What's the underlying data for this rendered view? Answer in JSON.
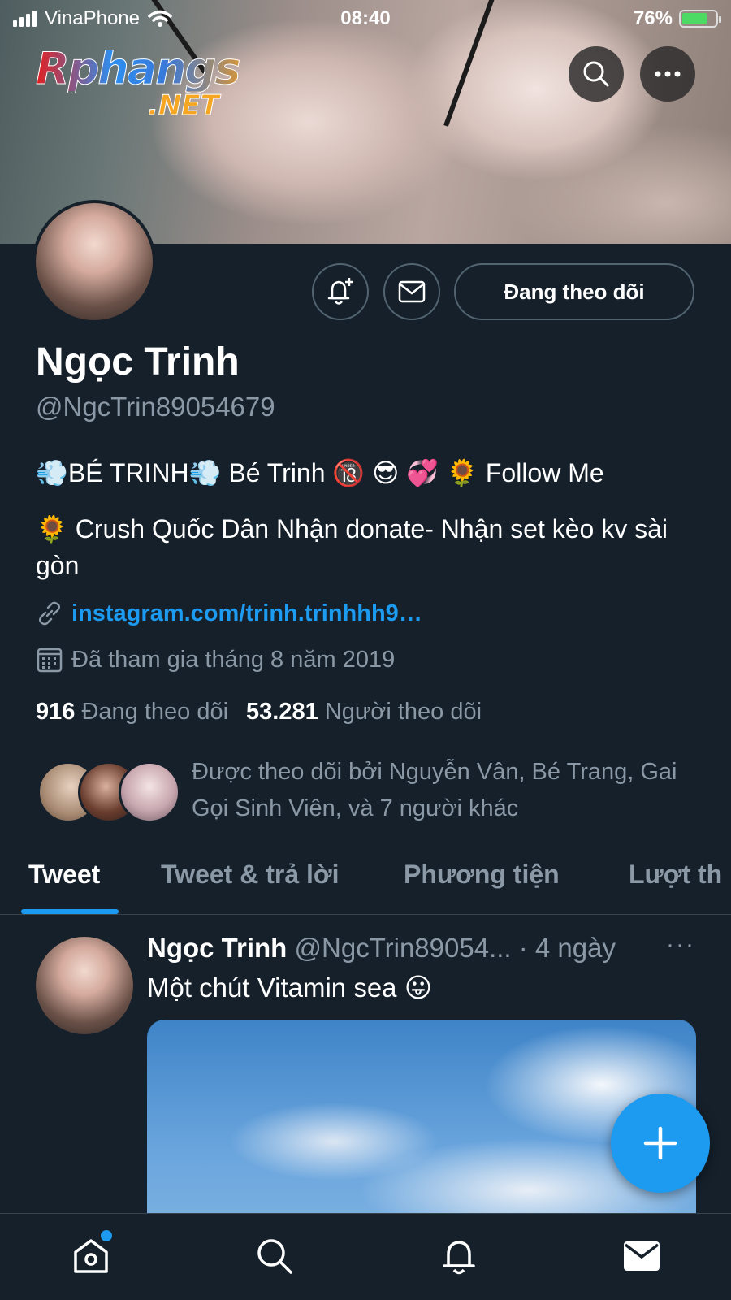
{
  "status_bar": {
    "carrier": "VinaPhone",
    "time": "08:40",
    "battery": "76%"
  },
  "watermark": {
    "line1": "Rphangs",
    "line2": ".NET"
  },
  "profile": {
    "name": "Ngọc Trinh",
    "handle": "@NgcTrin89054679",
    "follow_button": "Đang theo dõi",
    "bio_line1": "💨BÉ TRINH💨 Bé Trinh 🔞 😎 💞 🌻 Follow Me",
    "bio_line2": "🌻 Crush Quốc Dân Nhận donate- Nhận set kèo kv sài gòn",
    "link": "instagram.com/trinh.trinhhh9…",
    "joined": "Đã tham gia tháng 8 năm 2019",
    "following_count": "916",
    "following_label": "Đang theo dõi",
    "followers_count": "53.281",
    "followers_label": "Người theo dõi",
    "followed_by": "Được theo dõi bởi Nguyễn Vân, Bé Trang, Gai Gọi Sinh Viên, và 7 người khác"
  },
  "tabs": [
    {
      "label": "Tweet"
    },
    {
      "label": "Tweet & trả lời"
    },
    {
      "label": "Phương tiện"
    },
    {
      "label": "Lượt th"
    }
  ],
  "tweet": {
    "name": "Ngọc Trinh",
    "handle": "@NgcTrin89054...",
    "time": " · 4 ngày",
    "text": "Một chút Vitamin sea 😛",
    "more": "···"
  },
  "icons": {
    "top_search": "search-icon",
    "top_more": "more-icon",
    "notify": "bell-plus-icon",
    "message": "mail-icon",
    "link": "link-icon",
    "calendar": "calendar-icon",
    "fab": "plus-icon",
    "nav": [
      "home-icon",
      "search-icon",
      "bell-icon",
      "mail-icon"
    ]
  },
  "colors": {
    "background": "#15202b",
    "accent": "#1d9bf0",
    "secondary_text": "#8b98a5"
  }
}
